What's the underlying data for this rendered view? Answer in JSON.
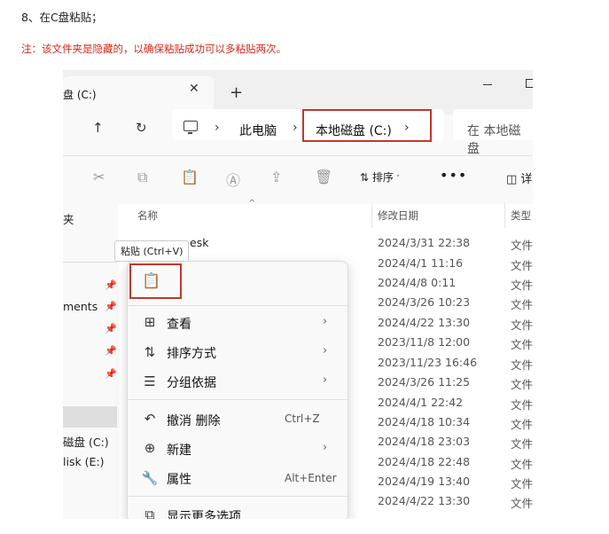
{
  "step": "8、在C盘粘贴；",
  "note": "注：该文件夹是隐藏的，以确保粘贴成功可以多粘贴两次。",
  "tab": {
    "title": "盘 (C:)",
    "close": "✕",
    "new": "+"
  },
  "nav": {
    "up": "↑",
    "refresh": "↻"
  },
  "address": {
    "crumb1": "此电脑",
    "crumb2": "本地磁盘 (C:)",
    "chev": "›"
  },
  "search": {
    "placeholder": "在 本地磁盘"
  },
  "toolbar": {
    "sort_label": "排序",
    "more": "•••",
    "details": "详"
  },
  "columns": {
    "name": "名称",
    "date": "修改日期",
    "type": "类型"
  },
  "sidebar": {
    "item1": "夹",
    "item2": "ments",
    "drive_c": "磁盘 (C:)",
    "drive_e": "lisk (E:)"
  },
  "files": [
    {
      "name": "esk",
      "date": "2024/3/31 22:38",
      "type": "文件"
    },
    {
      "name": "",
      "date": "2024/4/1 11:16",
      "type": "文件"
    },
    {
      "name": "",
      "date": "2024/4/8 0:11",
      "type": "文件"
    },
    {
      "name": "",
      "date": "2024/3/26 10:23",
      "type": "文件"
    },
    {
      "name": "",
      "date": "2024/4/22 13:30",
      "type": "文件"
    },
    {
      "name": "",
      "date": "2023/11/8 12:00",
      "type": "文件"
    },
    {
      "name": "",
      "date": "2023/11/23 16:46",
      "type": "文件"
    },
    {
      "name": "",
      "date": "2024/3/26 11:25",
      "type": "文件"
    },
    {
      "name": "",
      "date": "2024/4/1 22:42",
      "type": "文件"
    },
    {
      "name": "",
      "date": "2024/4/18 10:34",
      "type": "文件"
    },
    {
      "name": "",
      "date": "2024/4/18 23:03",
      "type": "文件"
    },
    {
      "name": "",
      "date": "2024/4/18 22:48",
      "type": "文件"
    },
    {
      "name": "",
      "date": "2024/4/19 13:40",
      "type": "文件"
    },
    {
      "name": "",
      "date": "2024/4/22 13:30",
      "type": "文件"
    }
  ],
  "tooltip": "粘贴 (Ctrl+V)",
  "menu": {
    "view": "查看",
    "sort": "排序方式",
    "group": "分组依据",
    "undo": "撤消 删除",
    "undo_shortcut": "Ctrl+Z",
    "new": "新建",
    "properties": "属性",
    "properties_shortcut": "Alt+Enter",
    "more_options": "显示更多选项",
    "arrow": "›"
  },
  "colors": {
    "highlight": "#c0392b",
    "note_red": "#d9291c"
  }
}
